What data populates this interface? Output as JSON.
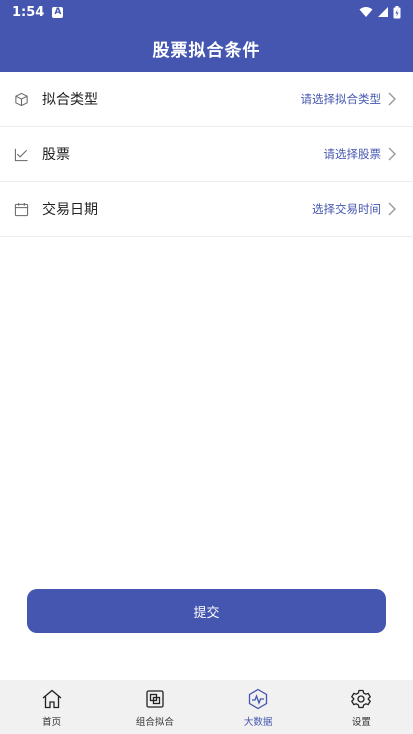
{
  "status_bar": {
    "time": "1:54",
    "notif_badge": "A"
  },
  "header": {
    "title": "股票拟合条件"
  },
  "rows": [
    {
      "label": "拟合类型",
      "value": "请选择拟合类型",
      "icon": "cube-icon"
    },
    {
      "label": "股票",
      "value": "请选择股票",
      "icon": "chart-check-icon"
    },
    {
      "label": "交易日期",
      "value": "选择交易时间",
      "icon": "calendar-icon"
    }
  ],
  "submit": {
    "label": "提交"
  },
  "tabbar": {
    "tabs": [
      {
        "label": "首页",
        "icon": "home-icon"
      },
      {
        "label": "组合拟合",
        "icon": "layers-icon"
      },
      {
        "label": "大数据",
        "icon": "pulse-icon",
        "active": true
      },
      {
        "label": "设置",
        "icon": "gear-icon"
      }
    ]
  },
  "colors": {
    "primary": "#4456b0",
    "tab_bg": "#f1f1f1"
  }
}
